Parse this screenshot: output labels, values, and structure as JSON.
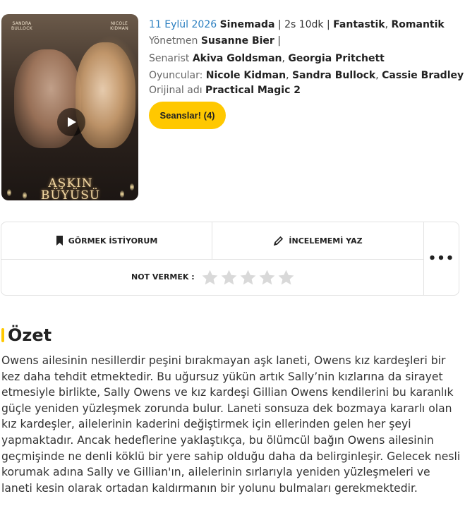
{
  "poster": {
    "credit_left": "SANDRA\nBULLOCK",
    "credit_right": "NICOLE\nKIDMAN",
    "title_art": "AŞKIN BÜYÜSÜ"
  },
  "info": {
    "date": "11 Eylül 2026",
    "status": "Sinemada",
    "separator": "|",
    "duration": "2s 10dk",
    "genres": [
      "Fantastik",
      "Romantik"
    ],
    "director_label": "Yönetmen",
    "director": "Susanne Bier",
    "writer_label": "Senarist",
    "writers": [
      "Akiva Goldsman",
      "Georgia Pritchett"
    ],
    "cast_label": "Oyuncular:",
    "cast": [
      "Nicole Kidman",
      "Sandra Bullock",
      "Cassie Bradley"
    ],
    "original_label": "Orijinal adı",
    "original_title": "Practical Magic 2"
  },
  "buttons": {
    "showtimes": "Seanslar! (4)",
    "watchlist": "GÖRMEK İSTİYORUM",
    "review": "İNCELEMEMİ YAZ",
    "more": "•••"
  },
  "rating": {
    "label": "NOT VERMEK :",
    "max_stars": 5,
    "current": 0,
    "star_color": "#d9d9d9"
  },
  "summary": {
    "title": "Özet",
    "text": "Owens ailesinin nesillerdir peşini bırakmayan aşk laneti, Owens kız kardeşleri bir kez daha tehdit etmektedir. Bu uğursuz yükün artık Sally’nin kızlarına da sirayet etmesiyle birlikte, Sally Owens ve kız kardeşi Gillian Owens kendilerini bu karanlık güçle yeniden yüzleşmek zorunda bulur. Laneti sonsuza dek bozmaya kararlı olan kız kardeşler, ailelerinin kaderini değiştirmek için ellerinden gelen her şeyi yapmaktadır. Ancak hedeflerine yaklaştıkça, bu ölümcül bağın Owens ailesinin geçmişinde ne denli köklü bir yere sahip olduğu daha da belirginleşir. Gelecek nesli korumak adına Sally ve Gillian'ın, ailelerinin sırlarıyla yeniden yüzleşmeleri ve laneti kesin olarak ortadan kaldırmanın bir yolunu bulmaları gerekmektedir."
  },
  "colors": {
    "accent": "#ffc800",
    "link_blue": "#2b7fc0"
  }
}
